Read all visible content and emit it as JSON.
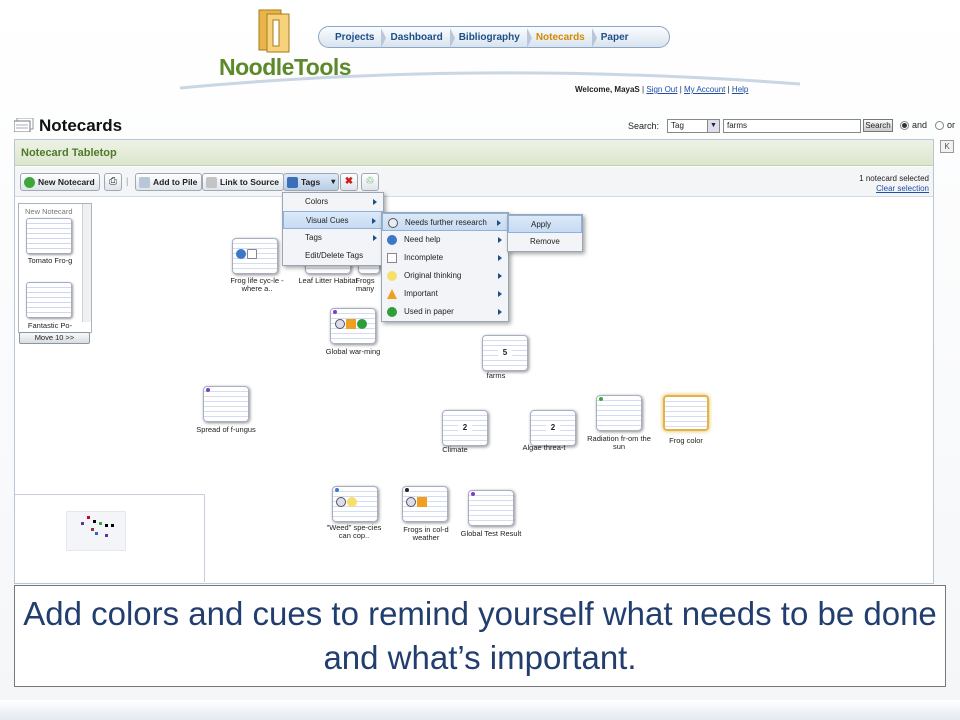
{
  "logo": {
    "text": "NoodleTools"
  },
  "nav": [
    "Projects",
    "Dashboard",
    "Bibliography",
    "Notecards",
    "Paper"
  ],
  "welcome": {
    "prefix": "Welcome, MayaS",
    "sign_out": "Sign Out",
    "my_account": "My Account",
    "help": "Help",
    "sep": "|"
  },
  "page_title": "Notecards",
  "search": {
    "label": "Search:",
    "field": "Tag",
    "value": "farms",
    "button": "Search",
    "and_label": "and",
    "or_label": "or"
  },
  "panel": {
    "title": "Notecard Tabletop",
    "collapse": "K"
  },
  "toolbar": {
    "new_notecard": "New Notecard",
    "add_to_pile": "Add to Pile",
    "link_to_source": "Link to Source",
    "tags": "Tags",
    "selected_count": "1 notecard selected",
    "clear_selection": "Clear selection"
  },
  "pile": {
    "label": "New Notecard",
    "cards": [
      "Tomato Fro-g",
      "Fantastic Po-"
    ],
    "move_button": "Move 10 >>"
  },
  "cards": [
    {
      "label": "Frog life cyc-le - where a..",
      "count": ""
    },
    {
      "label": "Leaf Litter Habitat",
      "count": ""
    },
    {
      "label": "Frogs many",
      "count": ""
    },
    {
      "label": "Global war-ming",
      "count": ""
    },
    {
      "label": "farms",
      "count": "5"
    },
    {
      "label": "Spread of f-ungus",
      "count": ""
    },
    {
      "label": "Climate",
      "count": "2"
    },
    {
      "label": "Algae threa-t",
      "count": "2"
    },
    {
      "label": "Radiation fr-om the sun",
      "count": ""
    },
    {
      "label": "Frog color",
      "count": ""
    },
    {
      "label": "\"Weed\" spe-cies can cop..",
      "count": ""
    },
    {
      "label": "Frogs in col-d weather",
      "count": ""
    },
    {
      "label": "Global Test Result",
      "count": ""
    }
  ],
  "tags_menu": [
    "Colors",
    "Visual Cues",
    "Tags",
    "Edit/Delete Tags"
  ],
  "visual_cues_menu": [
    {
      "label": "Needs further research",
      "icon": "magnifier-icon"
    },
    {
      "label": "Need help",
      "icon": "speech-bubble-icon"
    },
    {
      "label": "Incomplete",
      "icon": "blank-page-icon"
    },
    {
      "label": "Original thinking",
      "icon": "lightbulb-icon"
    },
    {
      "label": "Important",
      "icon": "warning-icon"
    },
    {
      "label": "Used in paper",
      "icon": "check-circle-icon"
    }
  ],
  "apply_menu": [
    "Apply",
    "Remove"
  ],
  "caption": "Add colors and cues to remind yourself what needs to be done and what’s important.",
  "colors": {
    "brand_green": "#5c8a2a",
    "nav_blue": "#1d4f86",
    "active_orange": "#d48a00",
    "caption_text": "#223e6e"
  }
}
